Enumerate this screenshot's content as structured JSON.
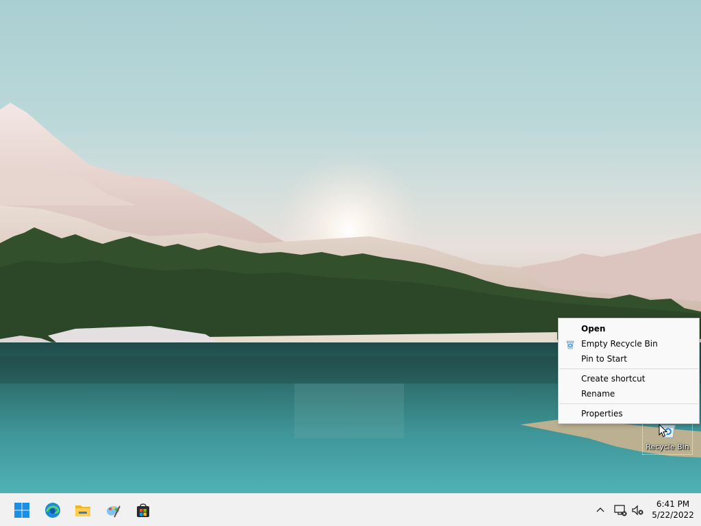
{
  "desktop": {
    "icons": [
      {
        "label": "Recycle Bin",
        "icon": "recycle-bin-icon",
        "selected": true
      }
    ]
  },
  "context_menu": {
    "groups": [
      [
        {
          "label": "Open",
          "bold": true
        },
        {
          "label": "Empty Recycle Bin",
          "icon": "recycle-bin-icon"
        },
        {
          "label": "Pin to Start"
        }
      ],
      [
        {
          "label": "Create shortcut"
        },
        {
          "label": "Rename"
        }
      ],
      [
        {
          "label": "Properties"
        }
      ]
    ]
  },
  "taskbar": {
    "apps": [
      {
        "icon": "windows-start-icon"
      },
      {
        "icon": "edge-icon"
      },
      {
        "icon": "file-explorer-icon"
      },
      {
        "icon": "paint-icon"
      },
      {
        "icon": "microsoft-store-icon"
      }
    ],
    "tray": {
      "icons": [
        "chevron-up-icon",
        "network-icon",
        "volume-muted-icon"
      ],
      "time": "6:41 PM",
      "date": "5/22/2022"
    }
  },
  "colors": {
    "taskbar_bg": "#f1f1f1",
    "menu_bg": "#f9f9f9",
    "accent": "#0078d4"
  }
}
